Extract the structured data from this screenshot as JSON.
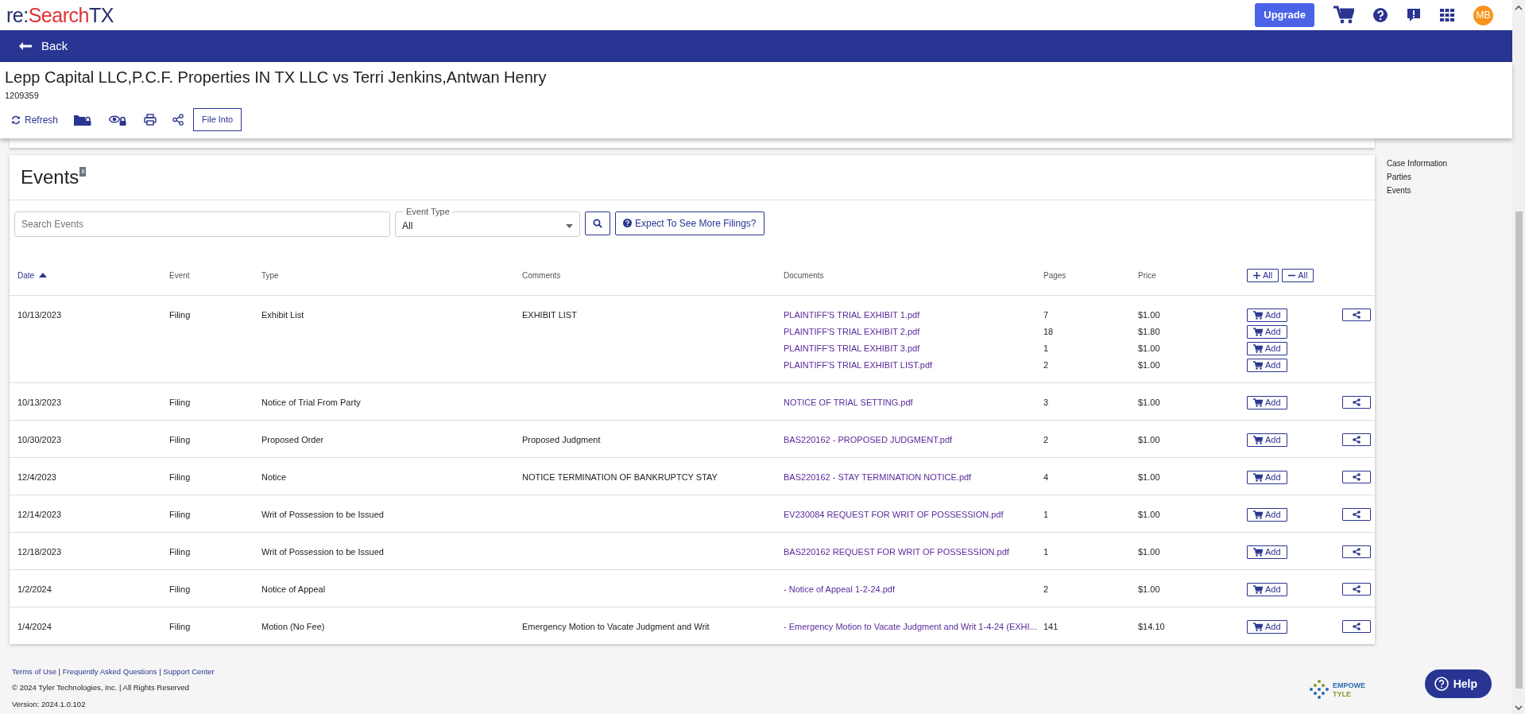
{
  "topbar": {
    "logo": {
      "prefix": "re:",
      "name": "Search",
      "suffix": "TX"
    },
    "upgrade": "Upgrade",
    "avatar": "MB"
  },
  "back": "Back",
  "case": {
    "title": "Lepp Capital LLC,P.C.F. Properties IN TX LLC vs Terri Jenkins,Antwan Henry",
    "number": "1209359"
  },
  "toolbar": [
    {
      "kind": "refresh",
      "label": "Refresh"
    },
    {
      "kind": "folder-lock"
    },
    {
      "kind": "eye-lock"
    },
    {
      "kind": "print"
    },
    {
      "kind": "share"
    },
    {
      "kind": "outlined",
      "label": "File Into"
    }
  ],
  "side_nav": [
    "Case Information",
    "Parties",
    "Events"
  ],
  "events": {
    "title": "Events",
    "badge": "8",
    "search": {
      "placeholder": "Search Events"
    },
    "event_type": {
      "label": "Event Type",
      "value": "All"
    },
    "expect_button": "Expect To See More Filings?",
    "columns": [
      {
        "label": "Date",
        "sorted": true
      },
      {
        "label": "Event",
        "sorted": false
      },
      {
        "label": "Type",
        "sorted": false
      },
      {
        "label": "Comments",
        "sorted": false
      },
      {
        "label": "Documents",
        "sorted": false
      },
      {
        "label": "Pages",
        "sorted": false
      },
      {
        "label": "Price",
        "sorted": false
      }
    ],
    "expand_all": "All",
    "collapse_all": "All",
    "rows": [
      {
        "date": "10/13/2023",
        "event": "Filing",
        "type": "Exhibit List",
        "comments": "EXHIBIT LIST",
        "documents": [
          {
            "name": "PLAINTIFF'S TRIAL EXHIBIT 1.pdf",
            "pages": "7",
            "price": "$1.00",
            "add": "Add"
          },
          {
            "name": "PLAINTIFF'S TRIAL EXHIBIT 2.pdf",
            "pages": "18",
            "price": "$1.80",
            "add": "Add"
          },
          {
            "name": "PLAINTIFF'S TRIAL EXHIBIT 3.pdf",
            "pages": "1",
            "price": "$1.00",
            "add": "Add"
          },
          {
            "name": "PLAINTIFF'S TRIAL EXHIBIT LIST.pdf",
            "pages": "2",
            "price": "$1.00",
            "add": "Add"
          }
        ]
      },
      {
        "date": "10/13/2023",
        "event": "Filing",
        "type": "Notice of Trial From Party",
        "documents": [
          {
            "name": "NOTICE OF TRIAL SETTING.pdf",
            "pages": "3",
            "price": "$1.00",
            "add": "Add"
          }
        ]
      },
      {
        "date": "10/30/2023",
        "event": "Filing",
        "type": "Proposed Order",
        "comments": "Proposed Judgment",
        "documents": [
          {
            "name": "BAS220162 - PROPOSED JUDGMENT.pdf",
            "pages": "2",
            "price": "$1.00",
            "add": "Add"
          }
        ]
      },
      {
        "date": "12/4/2023",
        "event": "Filing",
        "type": "Notice",
        "comments": "NOTICE TERMINATION OF BANKRUPTCY STAY",
        "documents": [
          {
            "name": "BAS220162 - STAY TERMINATION NOTICE.pdf",
            "pages": "4",
            "price": "$1.00",
            "add": "Add"
          }
        ]
      },
      {
        "date": "12/14/2023",
        "event": "Filing",
        "type": "Writ of Possession to be Issued",
        "documents": [
          {
            "name": "EV230084 REQUEST FOR WRIT OF POSSESSION.pdf",
            "pages": "1",
            "price": "$1.00",
            "add": "Add"
          }
        ]
      },
      {
        "date": "12/18/2023",
        "event": "Filing",
        "type": "Writ of Possession to be Issued",
        "documents": [
          {
            "name": "BAS220162 REQUEST FOR WRIT OF POSSESSION.pdf",
            "pages": "1",
            "price": "$1.00",
            "add": "Add"
          }
        ]
      },
      {
        "date": "1/2/2024",
        "event": "Filing",
        "type": "Notice of Appeal",
        "documents": [
          {
            "name": "- Notice of Appeal 1-2-24.pdf",
            "pages": "2",
            "price": "$1.00",
            "add": "Add"
          }
        ]
      },
      {
        "date": "1/4/2024",
        "event": "Filing",
        "type": "Motion (No Fee)",
        "comments": "Emergency Motion to Vacate Judgment and Writ",
        "documents": [
          {
            "name": "- Emergency Motion to Vacate Judgment and Writ 1-4-24 (EXHI...",
            "pages": "141",
            "price": "$14.10",
            "add": "Add"
          }
        ]
      }
    ]
  },
  "footer": {
    "links": [
      "Terms of Use",
      "Frequently Asked Questions",
      "Support Center"
    ],
    "separators": [
      "|",
      "|"
    ],
    "copyright": "© 2024 Tyler Technologies, Inc. | All Rights Reserved",
    "version": "Version: 2024.1.0.102",
    "brand": [
      "EMPOWE",
      "TYLE"
    ],
    "help": "Help"
  }
}
